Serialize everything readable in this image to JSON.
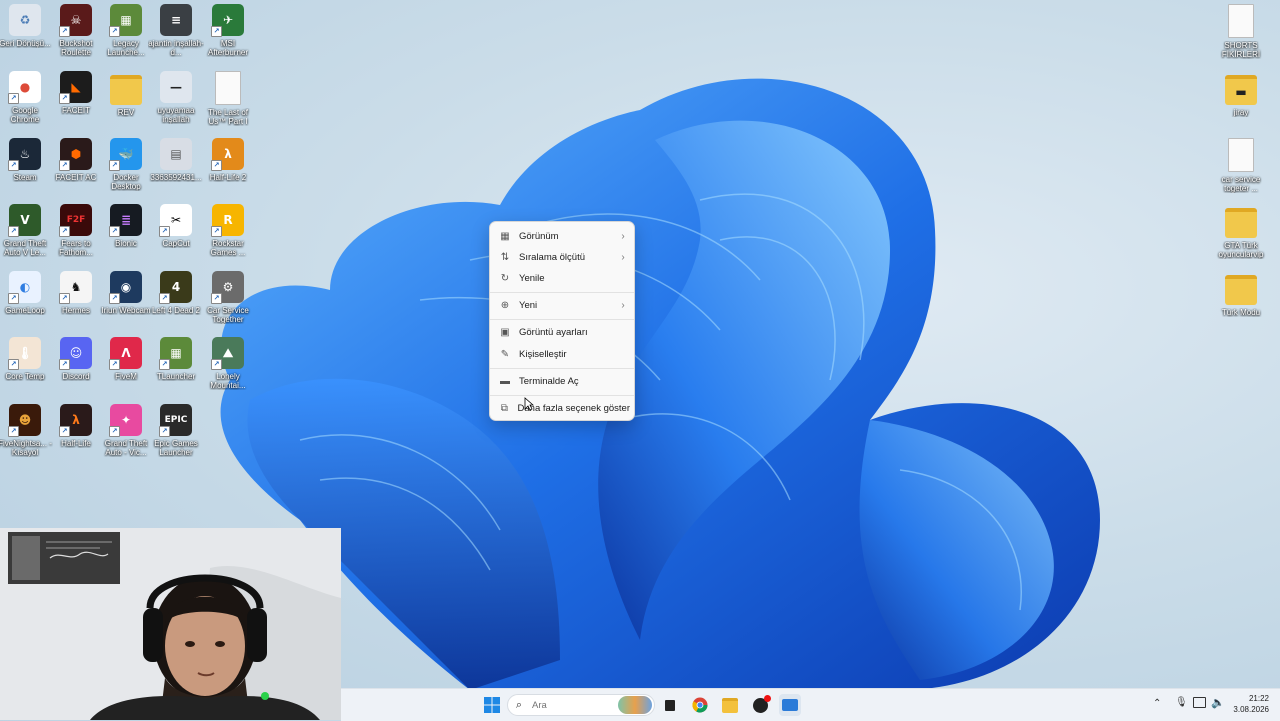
{
  "desktop_icons": [
    {
      "label": "Geri Dönüşü...",
      "icon": "recycle-bin-icon",
      "color": "#dfe6ee",
      "glyph": "♻",
      "text_color": "#4a7bb5"
    },
    {
      "label": "Buckshot Roulette",
      "icon": "buckshot-roulette-icon",
      "color": "#5a1a1a",
      "glyph": "☠"
    },
    {
      "label": "Legacy Launche...",
      "icon": "legacy-launcher-icon",
      "color": "#5c8a3a",
      "glyph": "▦"
    },
    {
      "label": "ajantin inşallah-d...",
      "icon": "text-file-icon",
      "color": "#3a3f44",
      "glyph": "≡"
    },
    {
      "label": "MSI Afterburner",
      "icon": "msi-afterburner-icon",
      "color": "#2a7a3a",
      "glyph": "✈"
    },
    {
      "label": "Google Chrome",
      "icon": "chrome-icon",
      "color": "#ffffff",
      "glyph": "●",
      "text_color": "#dd4b39"
    },
    {
      "label": "FACEIT",
      "icon": "faceit-icon",
      "color": "#1c1c1c",
      "glyph": "◣",
      "text_color": "#ff6a00"
    },
    {
      "label": "REV",
      "icon": "folder-icon",
      "color": "#f1c84b",
      "glyph": ""
    },
    {
      "label": "uyuyamaa inşallah",
      "icon": "text-file-icon",
      "color": "#dfe6ee",
      "glyph": "—",
      "text_color": "#222"
    },
    {
      "label": "The Last of Us™ Part I",
      "icon": "document-icon",
      "color": "#fafafa",
      "glyph": ""
    },
    {
      "label": "Steam",
      "icon": "steam-icon",
      "color": "#1b2838",
      "glyph": "♨"
    },
    {
      "label": "FACEIT AC",
      "icon": "faceit-ac-icon",
      "color": "#2a1a1a",
      "glyph": "⬢",
      "text_color": "#ff6a00"
    },
    {
      "label": "Docker Desktop",
      "icon": "docker-icon",
      "color": "#2496ed",
      "glyph": "🐳"
    },
    {
      "label": "3363592431...",
      "icon": "image-file-icon",
      "color": "#d8dde5",
      "glyph": "▤",
      "text_color": "#555"
    },
    {
      "label": "Half-Life 2",
      "icon": "half-life-2-icon",
      "color": "#e38a1a",
      "glyph": "λ"
    },
    {
      "label": "Grand Theft Auto V Le...",
      "icon": "gta-v-icon",
      "color": "#2e5a2a",
      "glyph": "V"
    },
    {
      "label": "Fears to Fathom...",
      "icon": "fears-to-fathom-icon",
      "color": "#3a0a0a",
      "glyph": "F2F",
      "text_color": "#e33"
    },
    {
      "label": "Bionic",
      "icon": "bionic-icon",
      "color": "#161b22",
      "glyph": "≣",
      "text_color": "#c77dff"
    },
    {
      "label": "CapCut",
      "icon": "capcut-icon",
      "color": "#ffffff",
      "glyph": "✂",
      "text_color": "#000"
    },
    {
      "label": "Rockstar Games ...",
      "icon": "rockstar-icon",
      "color": "#f7b500",
      "glyph": "R"
    },
    {
      "label": "GameLoop",
      "icon": "gameloop-icon",
      "color": "#e9f2ff",
      "glyph": "◐",
      "text_color": "#2f7de1"
    },
    {
      "label": "Hermes",
      "icon": "hermes-icon",
      "color": "#f5f5f5",
      "glyph": "♞",
      "text_color": "#111"
    },
    {
      "label": "Iriun Webcam",
      "icon": "iriun-webcam-icon",
      "color": "#1e3a5f",
      "glyph": "◉"
    },
    {
      "label": "Left 4 Dead 2",
      "icon": "left-4-dead-2-icon",
      "color": "#3a3a1a",
      "glyph": "4"
    },
    {
      "label": "Car Service Together",
      "icon": "car-service-icon",
      "color": "#6b6b6b",
      "glyph": "⚙"
    },
    {
      "label": "Core Temp",
      "icon": "core-temp-icon",
      "color": "#f3e5d5",
      "glyph": "🌡"
    },
    {
      "label": "Discord",
      "icon": "discord-icon",
      "color": "#5865f2",
      "glyph": "☺"
    },
    {
      "label": "FiveM",
      "icon": "fivem-icon",
      "color": "#e0284a",
      "glyph": "Λ"
    },
    {
      "label": "TLauncher",
      "icon": "tlauncher-icon",
      "color": "#5c8a3a",
      "glyph": "▦"
    },
    {
      "label": "Lonely Mountai...",
      "icon": "lonely-mountains-icon",
      "color": "#4a7a5a",
      "glyph": "⛰"
    },
    {
      "label": "FiveNightsa... - Kısayol",
      "icon": "five-nights-icon",
      "color": "#3a1a0a",
      "glyph": "☻",
      "text_color": "#e8a33a"
    },
    {
      "label": "Half-Life",
      "icon": "half-life-icon",
      "color": "#2a1a1a",
      "glyph": "λ",
      "text_color": "#ff7a1a"
    },
    {
      "label": "Grand Theft Auto - Vic...",
      "icon": "gta-vice-city-icon",
      "color": "#e84aa0",
      "glyph": "✦"
    },
    {
      "label": "Epic Games Launcher",
      "icon": "epic-games-icon",
      "color": "#2a2a2a",
      "glyph": "EPIC"
    },
    {
      "label": "SHORTS FİKİRLERİ",
      "icon": "document-icon",
      "color": "#fafafa",
      "glyph": ""
    },
    {
      "label": "jiray",
      "icon": "folder-icon",
      "color": "#f1c84b",
      "glyph": "▬",
      "text_color": "#222"
    },
    {
      "label": "car service togeter ...",
      "icon": "document-icon",
      "color": "#fafafa",
      "glyph": ""
    },
    {
      "label": "GTA Türk oyuncularvip",
      "icon": "folder-icon",
      "color": "#f1c84b",
      "glyph": ""
    },
    {
      "label": "Türk Modu",
      "icon": "folder-icon",
      "color": "#f1c84b",
      "glyph": ""
    }
  ],
  "context_menu": {
    "items": [
      {
        "label": "Görünüm",
        "icon": "grid-icon",
        "glyph": "▦",
        "submenu": true
      },
      {
        "label": "Sıralama ölçütü",
        "icon": "sort-icon",
        "glyph": "⇅",
        "submenu": true
      },
      {
        "label": "Yenile",
        "icon": "refresh-icon",
        "glyph": "↻",
        "submenu": false
      },
      {
        "label": "Yeni",
        "icon": "new-plus-icon",
        "glyph": "⊕",
        "submenu": true
      },
      {
        "label": "Görüntü ayarları",
        "icon": "display-settings-icon",
        "glyph": "▣",
        "submenu": false
      },
      {
        "label": "Kişiselleştir",
        "icon": "personalize-pen-icon",
        "glyph": "✎",
        "submenu": false
      },
      {
        "label": "Terminalde Aç",
        "icon": "terminal-icon",
        "glyph": "▬",
        "submenu": false
      },
      {
        "label": "Daha fazla seçenek göster",
        "icon": "more-options-icon",
        "glyph": "⧉",
        "submenu": false
      }
    ],
    "chevron": "›"
  },
  "taskbar": {
    "search_placeholder": "Ara",
    "time": "21:22",
    "date": "3.08.2026"
  }
}
